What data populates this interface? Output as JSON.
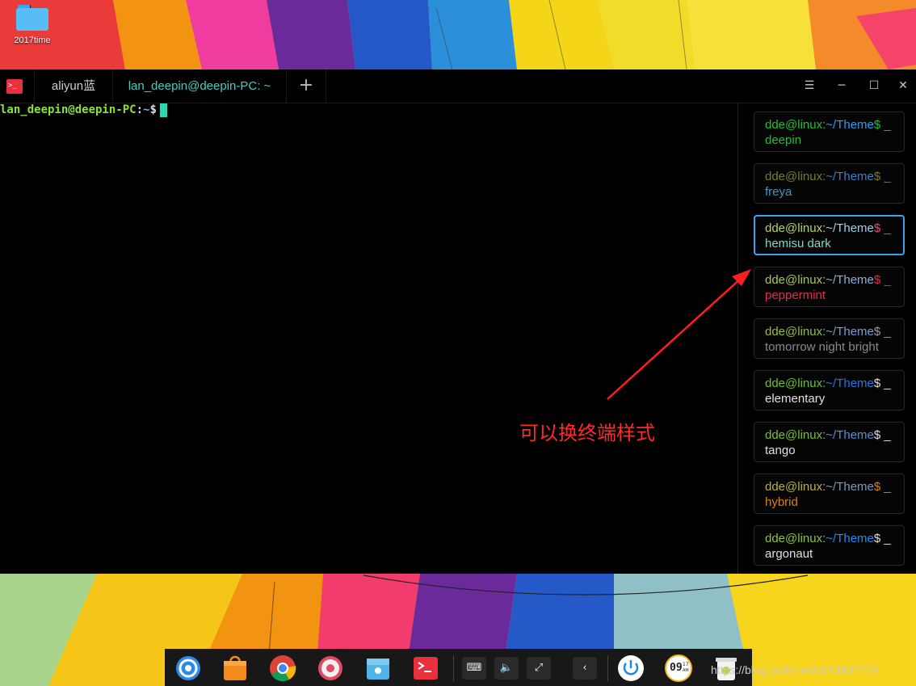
{
  "desktop": {
    "icon_label": "2017time"
  },
  "terminal": {
    "tabs": [
      {
        "label": "aliyun蓝"
      },
      {
        "label": "lan_deepin@deepin-PC: ~"
      }
    ],
    "add_tab_symbol": "+",
    "window_buttons": {
      "menu": "☰",
      "minimize": "─",
      "maximize": "☐",
      "close": "✕"
    },
    "prompt": {
      "user_host": "lan_deepin@deepin-PC",
      "sep": ":",
      "path": "~",
      "dollar": "$"
    }
  },
  "annotation": {
    "text": "可以换终端样式",
    "color": "#ff2a2a"
  },
  "themes": [
    {
      "user": "dde@linux:",
      "path": "~/Theme",
      "dollar": "$ _",
      "name": "deepin",
      "c_user": "#1ec12f",
      "c_path": "#2a9ef1",
      "c_dollar": "#1ec12f",
      "c_name": "#1ec12f",
      "selected": false
    },
    {
      "user": "dde@linux:",
      "path": "~/Theme",
      "dollar": "$ _",
      "name": "freya",
      "c_user": "#7a7d2b",
      "c_path": "#3c7fc2",
      "c_dollar": "#7a7d2b",
      "c_name": "#3f99c7",
      "selected": false
    },
    {
      "user": "dde@linux:",
      "path": "~/Theme",
      "dollar": "$ _",
      "name": "hemisu dark",
      "c_user": "#b6d46a",
      "c_path": "#9fd1e6",
      "c_dollar": "#e84d6e",
      "c_name": "#86d4c4",
      "selected": true
    },
    {
      "user": "dde@linux:",
      "path": "~/Theme",
      "dollar": "$ _",
      "name": "peppermint",
      "c_user": "#a7c65a",
      "c_path": "#8cb0d6",
      "c_dollar": "#e32d4e",
      "c_name": "#e32d4e",
      "selected": false
    },
    {
      "user": "dde@linux:",
      "path": "~/Theme",
      "dollar": "$ _",
      "name": "tomorrow night bright",
      "c_user": "#9aba3b",
      "c_path": "#7a9cd1",
      "c_dollar": "#9a9a9a",
      "c_name": "#8a8a8a",
      "selected": false
    },
    {
      "user": "dde@linux:",
      "path": "~/Theme",
      "dollar": "$ _",
      "name": "elementary",
      "c_user": "#6bbf2f",
      "c_path": "#2a75e6",
      "c_dollar": "#e0e0e0",
      "c_name": "#e0e0e0",
      "selected": false
    },
    {
      "user": "dde@linux:",
      "path": "~/Theme",
      "dollar": "$ _",
      "name": "tango",
      "c_user": "#79c233",
      "c_path": "#5a8fd0",
      "c_dollar": "#e0e0e0",
      "c_name": "#e0e0e0",
      "selected": false
    },
    {
      "user": "dde@linux:",
      "path": "~/Theme",
      "dollar": "$ _",
      "name": "hybrid",
      "c_user": "#b9b240",
      "c_path": "#7a9bb8",
      "c_dollar": "#df7f1d",
      "c_name": "#df7f1d",
      "selected": false
    },
    {
      "user": "dde@linux:",
      "path": "~/Theme",
      "dollar": "$ _",
      "name": "argonaut",
      "c_user": "#89c63a",
      "c_path": "#1f8df2",
      "c_dollar": "#e0e0e0",
      "c_name": "#e0e0e0",
      "selected": false
    }
  ],
  "dock": {
    "apps": [
      "launcher-icon",
      "store-icon",
      "chrome-icon",
      "settings-icon",
      "file-manager-icon",
      "terminal-icon"
    ],
    "tray": {
      "keyboard": "⌨",
      "volume": "🔈",
      "network": "⤢",
      "collapse": "‹"
    },
    "clock": "09",
    "clock_sub": "17",
    "clock_ampm": "AM"
  },
  "watermark": "https://blog.csdn.net/u013637774"
}
